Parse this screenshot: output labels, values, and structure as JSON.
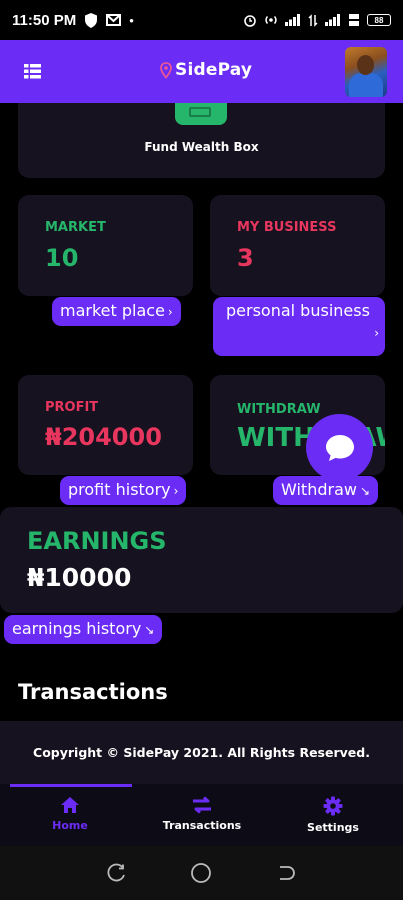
{
  "status_bar": {
    "time": "11:50 PM",
    "battery": "88"
  },
  "app_bar": {
    "brand": "SidePay"
  },
  "fund_card": {
    "label": "Fund Wealth Box"
  },
  "market": {
    "label": "MARKET",
    "value": "10",
    "link": "market place",
    "link_arrow": "›"
  },
  "business": {
    "label": "MY BUSINESS",
    "value": "3",
    "link_line1": "personal business",
    "link_arrow": "›"
  },
  "profit": {
    "label": "PROFIT",
    "value": "₦204000",
    "link": "profit history",
    "link_arrow": "›"
  },
  "withdraw": {
    "label": "WITHDRAW",
    "value": "WITHDRAW",
    "link": "Withdraw",
    "link_arrow": "↘"
  },
  "earnings": {
    "label": "EARNINGS",
    "value": "₦10000",
    "link": "earnings history",
    "link_arrow": "↘"
  },
  "transactions": {
    "title": "Transactions"
  },
  "footer": {
    "copyright": "Copyright © SidePay 2021. All Rights Reserved."
  },
  "bottom_nav": {
    "items": [
      {
        "label": "Home",
        "icon": "home-icon",
        "active": true
      },
      {
        "label": "Transactions",
        "icon": "transfer-icon",
        "active": false
      },
      {
        "label": "Settings",
        "icon": "gear-icon",
        "active": false
      }
    ]
  },
  "colors": {
    "accent": "#6b2cf5",
    "green": "#26b66b",
    "pink": "#e8365f",
    "card": "#16121f"
  }
}
